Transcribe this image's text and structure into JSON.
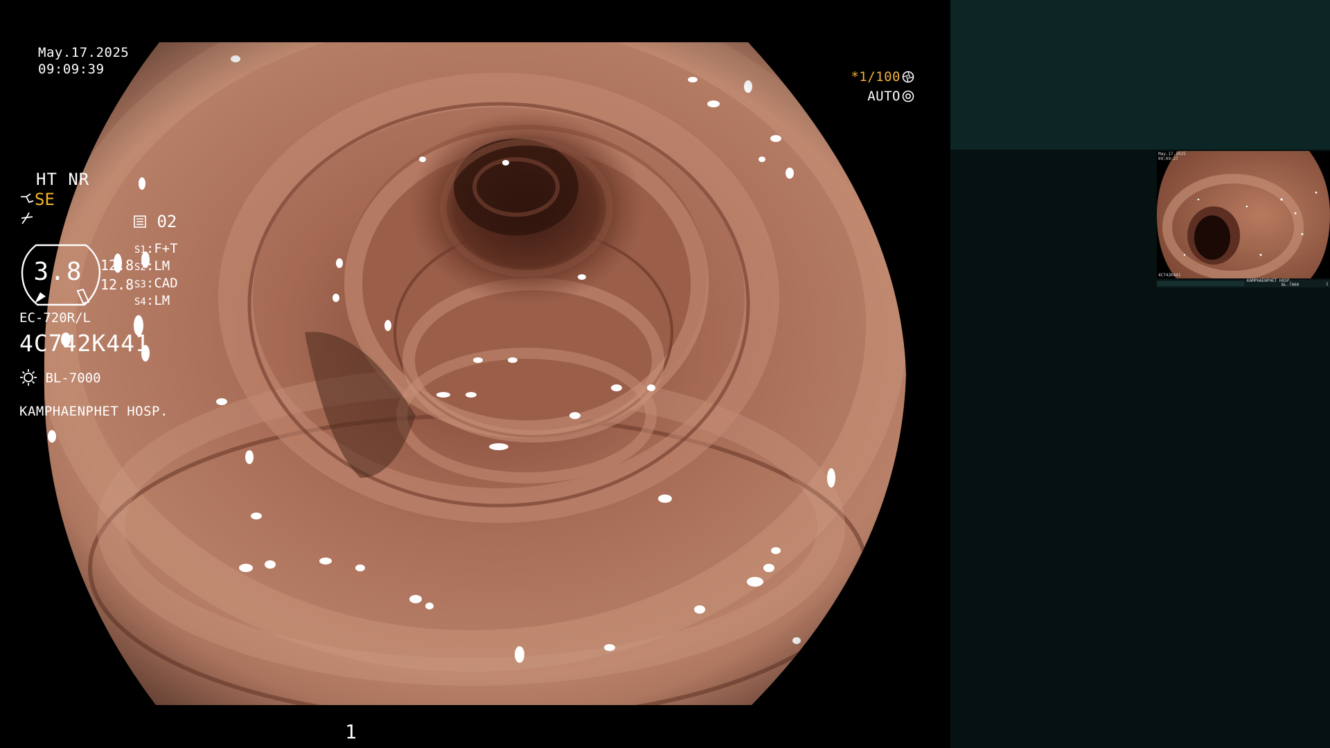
{
  "overlay": {
    "date": "May.17.2025",
    "time": "09:09:39",
    "shutter": "*1/100",
    "shutter_icon": "aperture-icon",
    "exposure": "AUTO",
    "exposure_icon": "auto-iris-icon"
  },
  "panel": {
    "enhancement": "HT NR",
    "structure": "SE",
    "structure_icon": "structure-enhance-icon",
    "mode_icon": "color-mode-icon",
    "memo_icon": "memo-icon",
    "memo_value": "02",
    "zoom_value": "3.8",
    "readout_1": "12.8",
    "readout_2": "12.8",
    "switches": [
      {
        "label": "S1",
        "value": "F+T"
      },
      {
        "label": "S2",
        "value": "LM"
      },
      {
        "label": "S3",
        "value": "CAD"
      },
      {
        "label": "S4",
        "value": "LM"
      }
    ],
    "scope_model": "EC-720R/L",
    "scope_serial": "4C742K441",
    "light_icon": "light-source-icon",
    "light_source": "BL-7000",
    "hospital": "KAMPHAENPHET HOSP.",
    "page_number": "1"
  },
  "thumbnail": {
    "date": "May.17.2025",
    "time": "09:09:27",
    "serial": "4C742K441",
    "hospital": "KAMPHAENPHET HOSP.",
    "light_source": "BL-7000",
    "page_number": "1"
  },
  "colors": {
    "panel_top": "#0d2525",
    "panel_body": "#061111",
    "shutter_amber": "#f2b23a",
    "structure_yellow": "#f4b623",
    "mucosa": "#b0735a",
    "lumen_dark": "#2a120c"
  }
}
